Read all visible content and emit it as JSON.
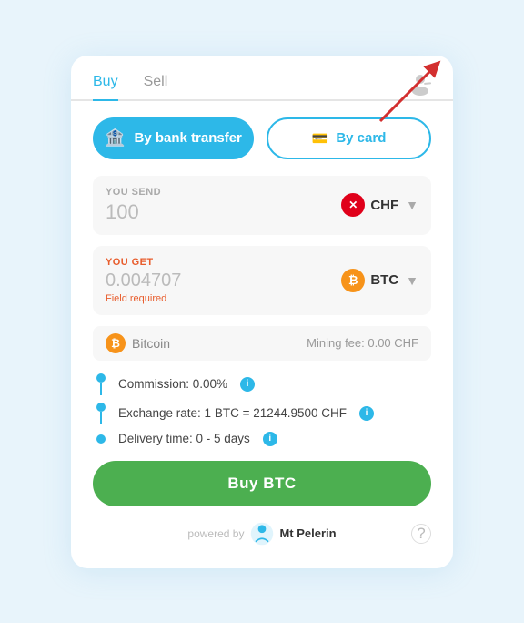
{
  "tabs": {
    "buy": "Buy",
    "sell": "Sell",
    "active": "buy"
  },
  "payment": {
    "bank_label": "By bank transfer",
    "card_label": "By card"
  },
  "send": {
    "label": "YOU SEND",
    "value": "100",
    "currency_code": "CHF",
    "currency_symbol": "✕"
  },
  "get": {
    "label": "YOU GET",
    "value": "0.004707",
    "currency_code": "BTC",
    "field_required": "Field required"
  },
  "bitcoin_row": {
    "name": "Bitcoin",
    "mining_fee": "Mining fee: 0.00 CHF"
  },
  "details": [
    {
      "text": "Commission: 0.00%",
      "has_info": true
    },
    {
      "text": "Exchange rate: 1 BTC = 21244.9500 CHF",
      "has_info": true
    },
    {
      "text": "Delivery time: 0 - 5 days",
      "has_info": true
    }
  ],
  "buy_button": "Buy BTC",
  "footer": {
    "powered_by": "powered by",
    "brand": "Mt\nPelerin"
  }
}
